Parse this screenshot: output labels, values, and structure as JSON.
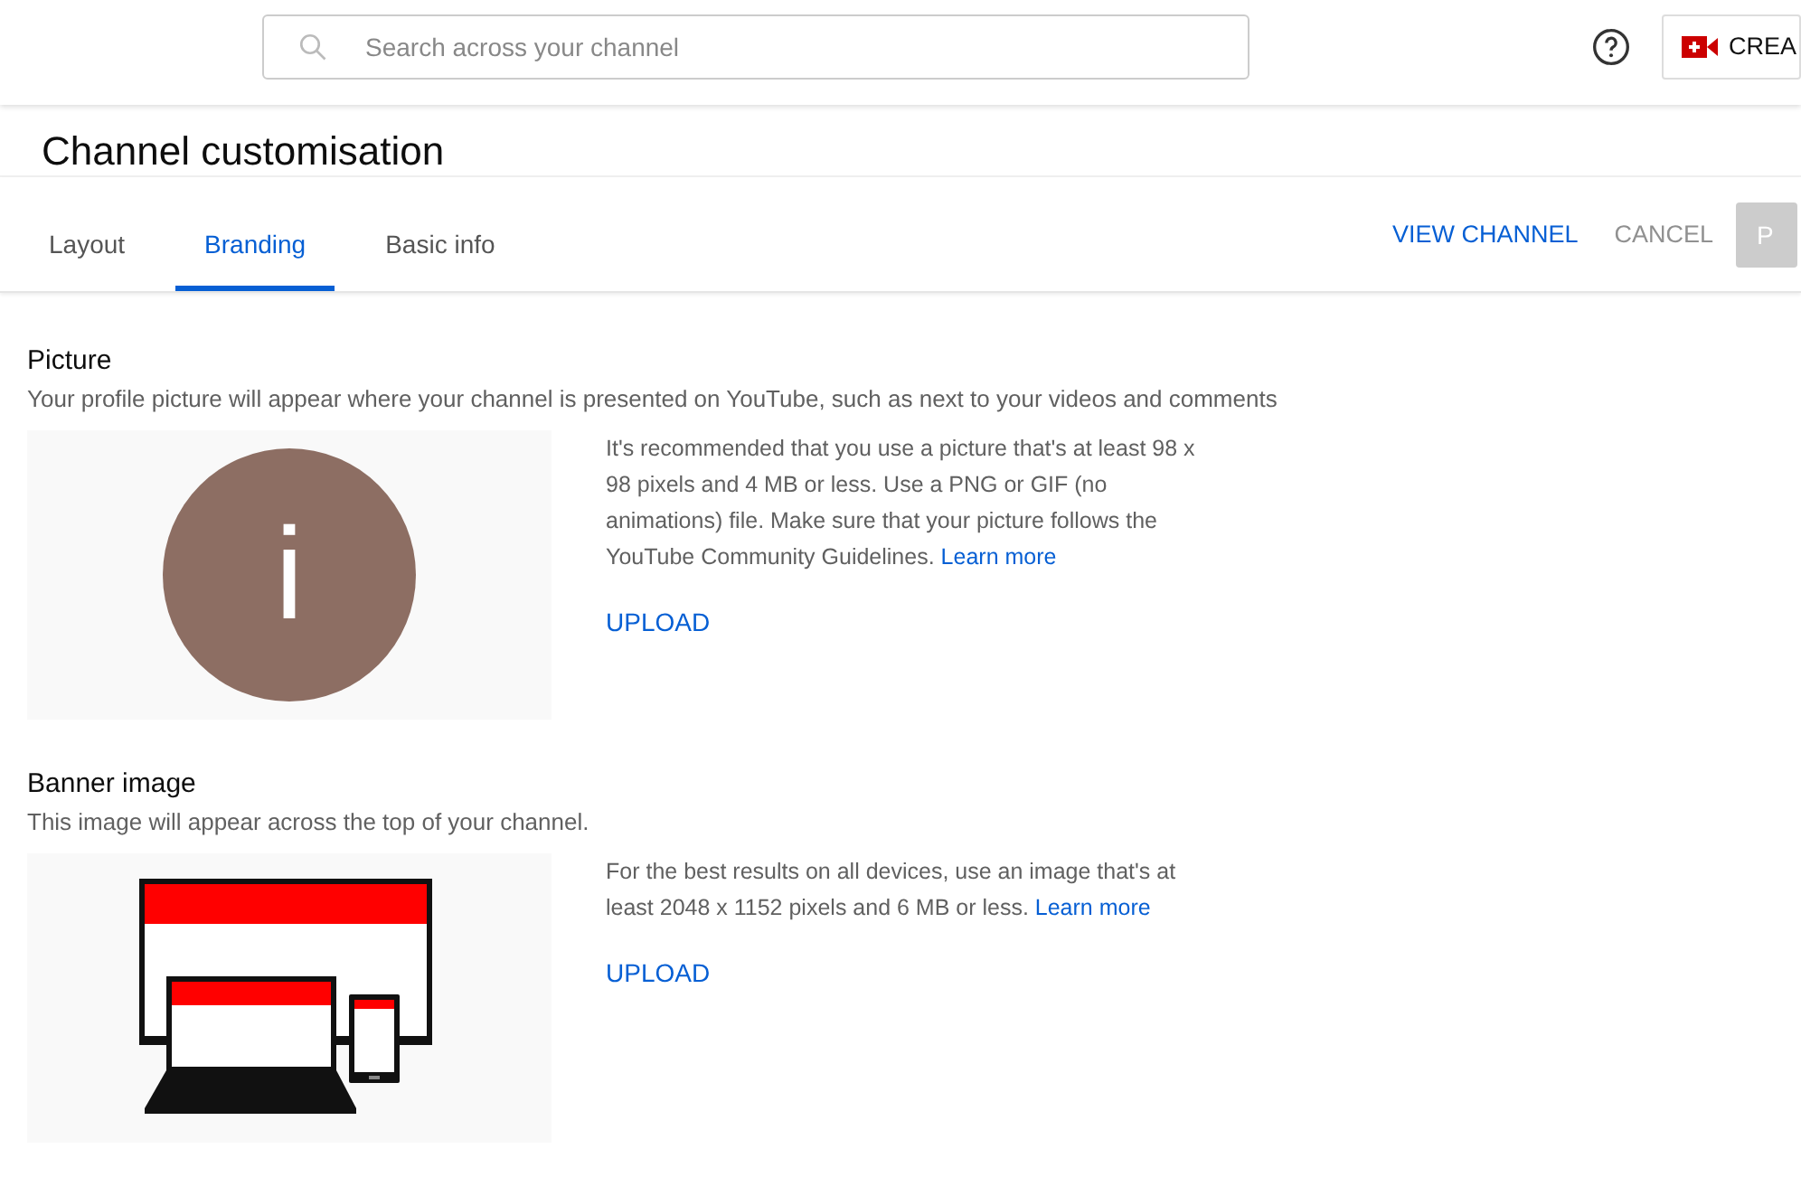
{
  "header": {
    "search": {
      "placeholder": "Search across your channel"
    },
    "create_button": "CREA"
  },
  "page_title": "Channel customisation",
  "tabs": [
    {
      "label": "Layout",
      "selected": false
    },
    {
      "label": "Branding",
      "selected": true
    },
    {
      "label": "Basic info",
      "selected": false
    }
  ],
  "actions": {
    "view_channel": "VIEW CHANNEL",
    "cancel": "CANCEL",
    "publish": {
      "label": "P",
      "disabled": true
    }
  },
  "sections": [
    {
      "title": "Picture",
      "description": "Your profile picture will appear where your channel is presented on YouTube, such as next to your videos and comments",
      "preview": {
        "kind": "avatar",
        "letter": "i",
        "color": "#8d6e63"
      },
      "guidance": "It's recommended that you use a picture that's at least 98 x 98 pixels and 4 MB or less. Use a PNG or GIF (no animations) file. Make sure that your picture follows the YouTube Community Guidelines.",
      "link": "Learn more",
      "upload": "UPLOAD"
    },
    {
      "title": "Banner image",
      "description": "This image will appear across the top of your channel.",
      "preview": {
        "kind": "devices"
      },
      "guidance": "For the best results on all devices, use an image that's at least 2048 x 1152 pixels and 6 MB or less.",
      "link": "Learn more",
      "upload": "UPLOAD"
    }
  ]
}
